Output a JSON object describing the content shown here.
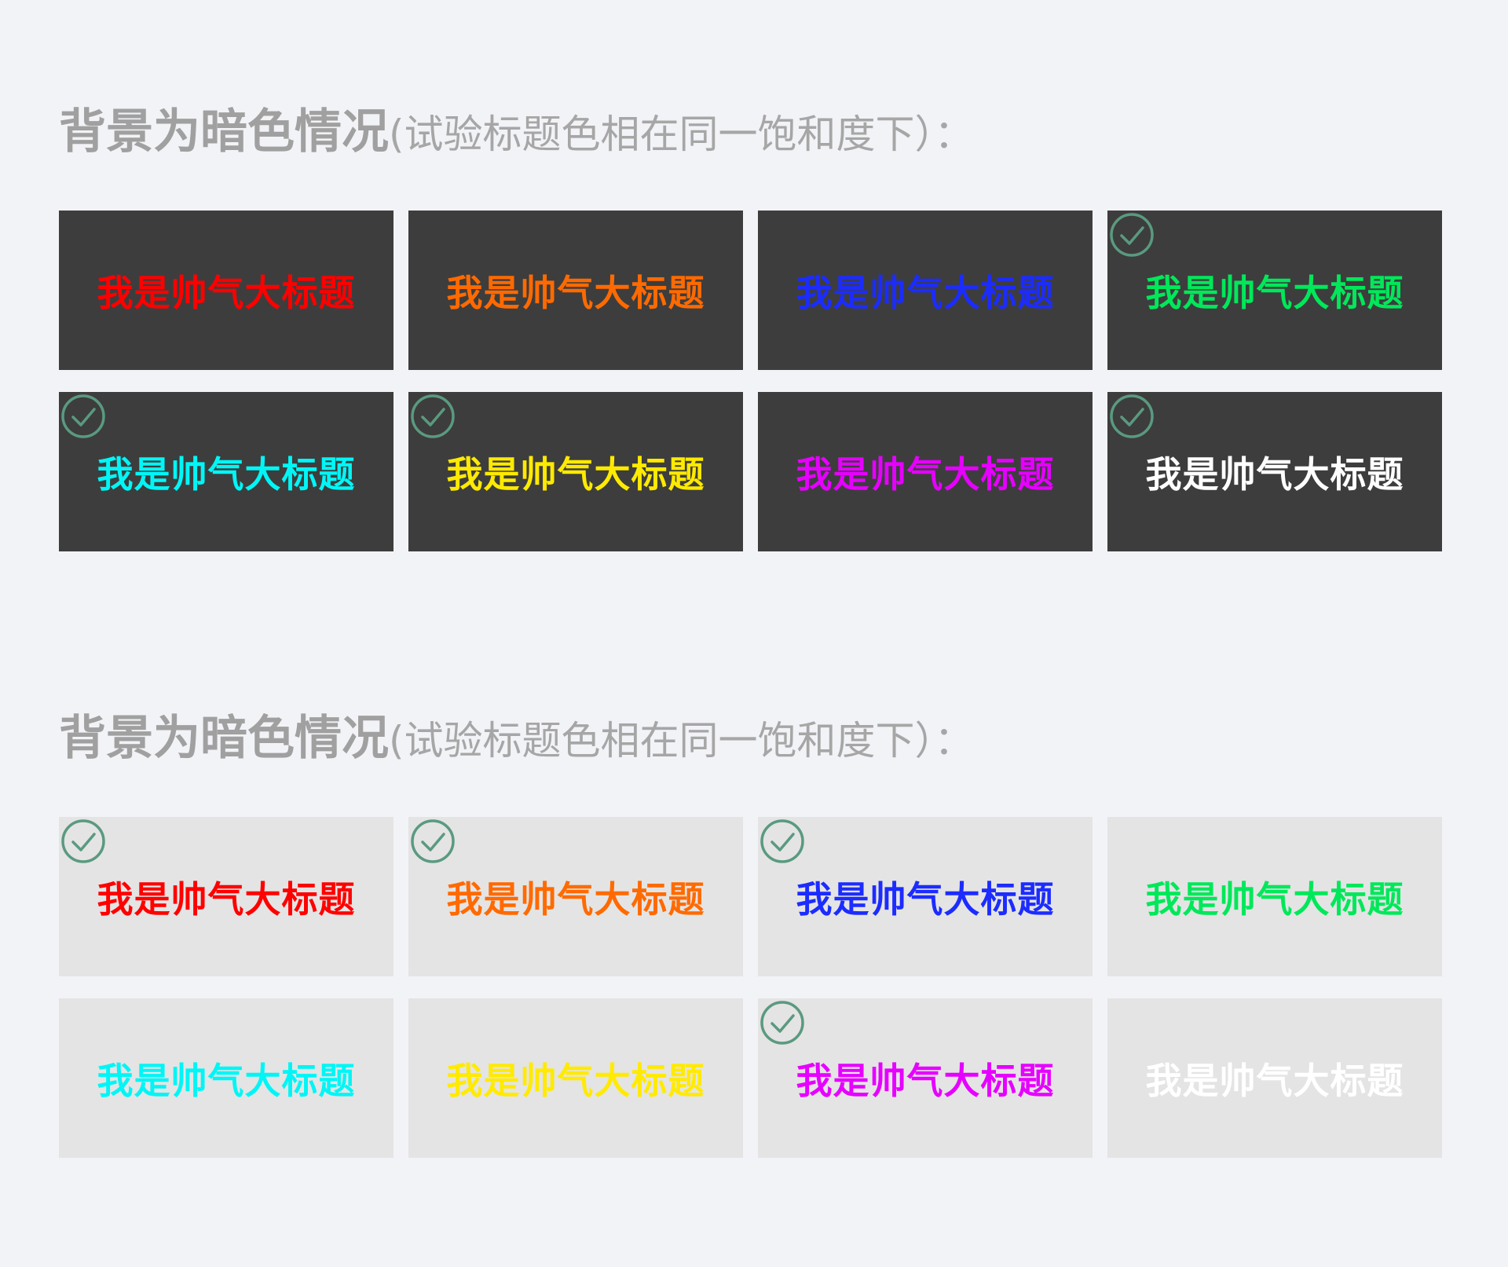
{
  "sections": [
    {
      "heading_bold": "背景为暗色情况",
      "heading_light": "(试验标题色相在同一饱和度下）：",
      "tiles": [
        {
          "text": "我是帅气大标题",
          "color": "#ff0000",
          "checked": false
        },
        {
          "text": "我是帅气大标题",
          "color": "#ff6a00",
          "checked": false
        },
        {
          "text": "我是帅气大标题",
          "color": "#1c2cff",
          "checked": false
        },
        {
          "text": "我是帅气大标题",
          "color": "#00e85a",
          "checked": true
        },
        {
          "text": "我是帅气大标题",
          "color": "#00f6f6",
          "checked": true
        },
        {
          "text": "我是帅气大标题",
          "color": "#ffea00",
          "checked": true
        },
        {
          "text": "我是帅气大标题",
          "color": "#e600ff",
          "checked": false
        },
        {
          "text": "我是帅气大标题",
          "color": "#ffffff",
          "checked": true
        }
      ]
    },
    {
      "heading_bold": "背景为暗色情况",
      "heading_light": "(试验标题色相在同一饱和度下）：",
      "tiles": [
        {
          "text": "我是帅气大标题",
          "color": "#ff0000",
          "checked": true
        },
        {
          "text": "我是帅气大标题",
          "color": "#ff6a00",
          "checked": true
        },
        {
          "text": "我是帅气大标题",
          "color": "#1c2cff",
          "checked": true
        },
        {
          "text": "我是帅气大标题",
          "color": "#00e85a",
          "checked": false
        },
        {
          "text": "我是帅气大标题",
          "color": "#00f6f6",
          "checked": false
        },
        {
          "text": "我是帅气大标题",
          "color": "#ffea00",
          "checked": false
        },
        {
          "text": "我是帅气大标题",
          "color": "#e600ff",
          "checked": true
        },
        {
          "text": "我是帅气大标题",
          "color": "#ffffff",
          "checked": false
        }
      ]
    }
  ],
  "theme": {
    "dark_tile_bg": "#3d3d3d",
    "light_tile_bg": "#e4e4e4",
    "check_color": "#5a9a80",
    "page_bg": "#f2f3f7",
    "heading_color": "#a0a0a0"
  }
}
